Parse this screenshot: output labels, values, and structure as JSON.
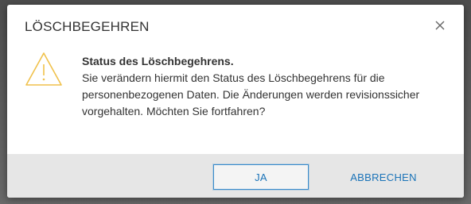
{
  "dialog": {
    "title": "LÖSCHBEGEHREN",
    "close_icon": "close-icon",
    "warning_icon": "warning-icon",
    "message_title": "Status des Löschbegehrens.",
    "message_line1": "Sie verändern hiermit den Status des Löschbegehrens für die",
    "message_line2": "personenbezogenen Daten. Die Änderungen werden revisionssicher",
    "message_line3": "vorgehalten. Möchten Sie fortfahren?",
    "buttons": {
      "yes_label": "JA",
      "cancel_label": "ABBRECHEN"
    }
  },
  "colors": {
    "accent": "#1a73b8",
    "warning": "#f0c14b",
    "footer_bg": "#e6e6e6",
    "text": "#333333"
  }
}
